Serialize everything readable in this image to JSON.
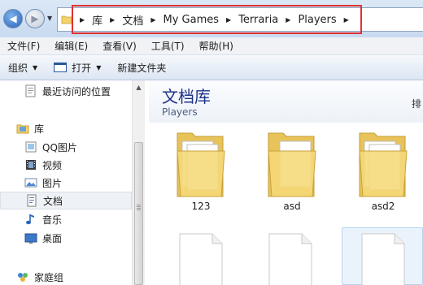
{
  "address": {
    "breadcrumbs": [
      "库",
      "文档",
      "My Games",
      "Terraria",
      "Players"
    ]
  },
  "menu": [
    "文件(F)",
    "编辑(E)",
    "查看(V)",
    "工具(T)",
    "帮助(H)"
  ],
  "toolbar": {
    "organize": "组织",
    "open": "打开",
    "new_folder": "新建文件夹"
  },
  "sidebar": {
    "recent": "最近访问的位置",
    "library": "库",
    "items": [
      "QQ图片",
      "视频",
      "图片",
      "文档",
      "音乐",
      "桌面"
    ],
    "homegroup": "家庭组"
  },
  "main": {
    "title": "文档库",
    "subtitle": "Players",
    "arrange_label": "排",
    "folders": [
      "123",
      "asd",
      "asd2"
    ]
  },
  "colors": {
    "accent_border": "#e03131",
    "title": "#1e3287",
    "folder": "#f3d36b"
  }
}
